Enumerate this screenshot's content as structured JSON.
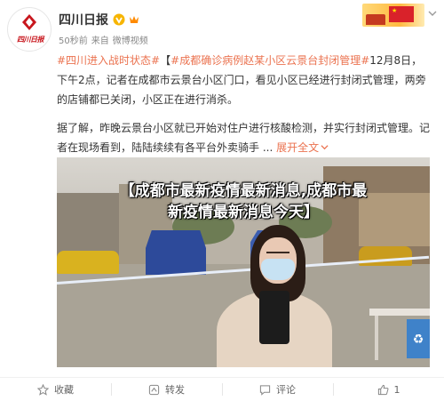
{
  "author": {
    "name": "四川日报",
    "avatar_text": "四川日报",
    "time": "50秒前",
    "source_prefix": "来自",
    "source": "微博视频"
  },
  "post": {
    "hashtag1": "#四川进入战时状态#",
    "bracket_open": "【",
    "hashtag2": "#成都确诊病例赵某小区云景台封闭管理#",
    "text1": "12月8日，下午2点，记者在成都市云景台小区门口，看见小区已经进行封闭式管理，两旁的店铺都已关闭，小区正在进行消杀。",
    "text2": "据了解，昨晚云景台小区就已开始对住户进行核酸检测，并实行封闭式管理。记者在现场看到，陆陆续续有各平台外卖骑手 ...",
    "expand_label": "展开全文",
    "expand_icon": "chevron-down-icon"
  },
  "media": {
    "headline_line1": "【成都市最新疫情最新消息,成都市最",
    "headline_line2": "新疫情最新消息今天】"
  },
  "actions": [
    {
      "label": "收藏",
      "icon": "star-icon"
    },
    {
      "label": "转发",
      "icon": "repost-icon"
    },
    {
      "label": "评论",
      "icon": "comment-icon"
    },
    {
      "label": "1",
      "icon": "like-icon"
    }
  ],
  "colors": {
    "accent": "#eb7350",
    "brand_red": "#c8161d",
    "verified": "#f7b500"
  }
}
